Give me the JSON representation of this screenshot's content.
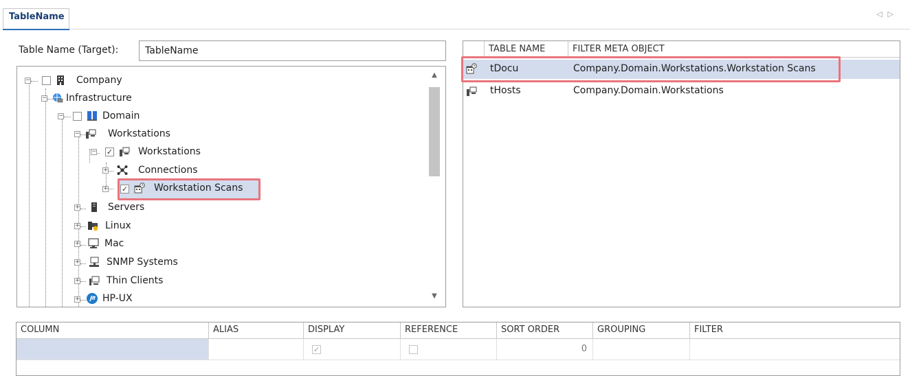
{
  "tab": {
    "label": "TableName",
    "nav_left": "◁",
    "nav_right": "▷"
  },
  "form": {
    "table_name_label": "Table Name (Target):",
    "table_name_value": "TableName"
  },
  "tree": {
    "nodes": [
      {
        "label": "Company",
        "icon": "building-icon",
        "checked": false
      },
      {
        "label": "Infrastructure",
        "icon": "globe-computer-icon"
      },
      {
        "label": "Domain",
        "icon": "domain-icon",
        "checked": false
      },
      {
        "label": "Workstations",
        "icon": "workstation-icon"
      },
      {
        "label": "Workstations",
        "icon": "workstation-icon",
        "checked": true
      },
      {
        "label": "Connections",
        "icon": "network-icon"
      },
      {
        "label": "Workstation Scans",
        "icon": "scan-calendar-icon",
        "checked": true,
        "selected": true
      },
      {
        "label": "Servers",
        "icon": "server-icon"
      },
      {
        "label": "Linux",
        "icon": "linux-icon"
      },
      {
        "label": "Mac",
        "icon": "mac-icon"
      },
      {
        "label": "SNMP Systems",
        "icon": "snmp-icon"
      },
      {
        "label": "Thin Clients",
        "icon": "thin-client-icon"
      },
      {
        "label": "HP-UX",
        "icon": "hp-icon"
      }
    ]
  },
  "filter_grid": {
    "headers": [
      "TABLE NAME",
      "FILTER META OBJECT"
    ],
    "rows": [
      {
        "name": "tDocu",
        "filter": "Company.Domain.Workstations.Workstation Scans",
        "icon": "scan-calendar-icon",
        "selected": true
      },
      {
        "name": "tHosts",
        "filter": "Company.Domain.Workstations",
        "icon": "workstation-icon"
      }
    ]
  },
  "column_table": {
    "headers": [
      "COLUMN",
      "ALIAS",
      "DISPLAY",
      "REFERENCE",
      "SORT ORDER",
      "GROUPING",
      "FILTER"
    ],
    "row": {
      "display_checked": true,
      "reference_checked": false,
      "sort_order": "0"
    }
  },
  "colors": {
    "highlight": "#e8747c",
    "selection": "#d3dced",
    "tab_accent": "#2a6fb8"
  }
}
